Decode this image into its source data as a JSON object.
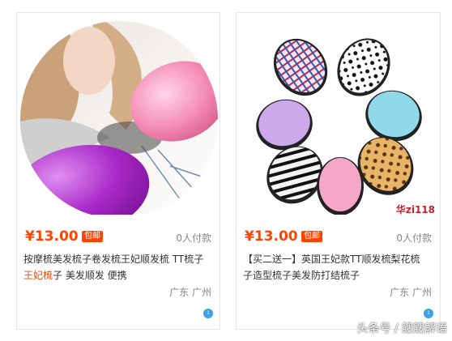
{
  "products": [
    {
      "price": "¥13.00",
      "tag": "包邮",
      "sold": "0人付款",
      "title_part1": "按摩梳美发梳子卷发梳王妃顺发梳  TT梳子",
      "title_highlight": "王妃梳",
      "title_part2": "子 美发顺发 便携",
      "location": "广东 广州",
      "badge": "1"
    },
    {
      "price": "¥13.00",
      "tag": "包邮",
      "sold": "0人付款",
      "title_part1": "【买二送一】英国王妃款TT顺发梳梨花梳",
      "title_highlight": "",
      "title_part2": "子造型梳子美发防打结梳子",
      "location": "广东 广州",
      "badge": "1",
      "image_watermark": "华zi118"
    }
  ],
  "page_watermark": "头条号 / 餿餿解语"
}
